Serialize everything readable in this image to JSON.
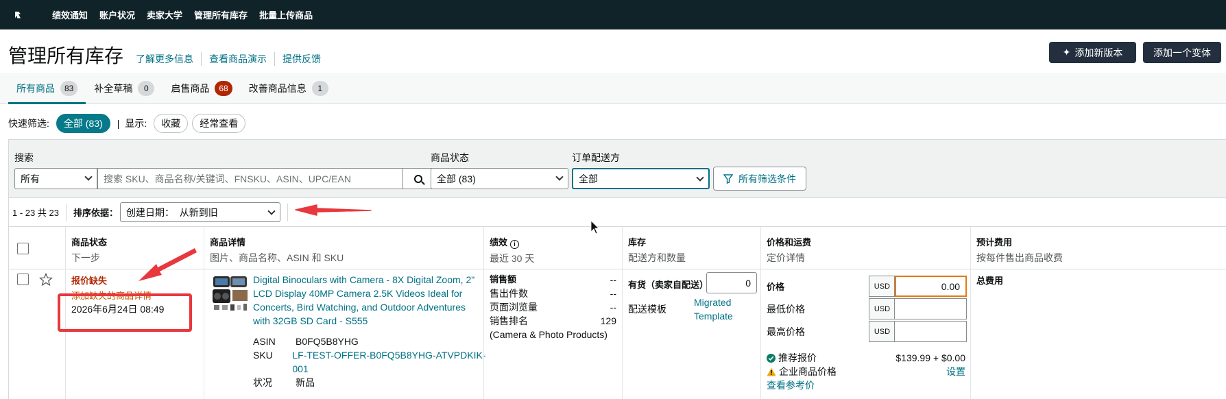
{
  "nav": {
    "items": [
      "绩效通知",
      "账户状况",
      "卖家大学",
      "管理所有库存",
      "批量上传商品"
    ]
  },
  "header": {
    "title": "管理所有库存",
    "links": [
      "了解更多信息",
      "查看商品演示",
      "提供反馈"
    ],
    "add_version_label": "添加新版本",
    "add_variant_label": "添加一个变体"
  },
  "tabs": [
    {
      "label": "所有商品",
      "count": "83"
    },
    {
      "label": "补全草稿",
      "count": "0"
    },
    {
      "label": "启售商品",
      "count": "68"
    },
    {
      "label": "改善商品信息",
      "count": "1"
    }
  ],
  "quick_filter": {
    "label": "快速筛选:",
    "all": "全部 (83)",
    "show_label": "显示:",
    "favorites": "收藏",
    "frequent": "经常查看"
  },
  "search": {
    "label": "搜索",
    "scope": "所有",
    "placeholder": "搜索 SKU、商品名称/关键词、FNSKU、ASIN、UPC/EAN",
    "status_label": "商品状态",
    "status_value": "全部 (83)",
    "fulfillment_label": "订单配送方",
    "fulfillment_value": "全部",
    "all_filters_label": "所有筛选条件"
  },
  "results": {
    "range": "1 - 23 共 23",
    "sort_label": "排序依据：",
    "sort_value": "创建日期：  从新到旧"
  },
  "columns": {
    "status": {
      "title": "商品状态",
      "sub": "下一步"
    },
    "details": {
      "title": "商品详情",
      "sub": "图片、商品名称、ASIN 和 SKU"
    },
    "performance": {
      "title": "绩效",
      "sub": "最近 30 天"
    },
    "inventory": {
      "title": "库存",
      "sub": "配送方和数量"
    },
    "pricing": {
      "title": "价格和运费",
      "sub": "定价详情"
    },
    "fees": {
      "title": "预计费用",
      "sub": "按每件售出商品收费"
    }
  },
  "row": {
    "status": "报价缺失",
    "next_step": "添加缺失的商品详情",
    "created": "2026年6月24日 08:49",
    "title": "Digital Binoculars with Camera - 8X Digital Zoom, 2\" LCD Display 40MP Camera 2.5K Videos Ideal for Concerts, Bird Watching, and Outdoor Adventures with 32GB SD Card - S555",
    "asin_label": "ASIN",
    "asin": "B0FQ5B8YHG",
    "sku_label": "SKU",
    "sku": "LF-TEST-OFFER-B0FQ5B8YHG-ATVPDKIK-001",
    "condition_label": "状况",
    "condition": "新品",
    "perf": {
      "sales_label": "销售额",
      "sales": "--",
      "units_label": "售出件数",
      "units": "--",
      "views_label": "页面浏览量",
      "views": "--",
      "rank_label": "销售排名",
      "rank": "129",
      "rank_category": "(Camera & Photo Products)"
    },
    "inventory": {
      "fulfillment": "有货（卖家自配送）",
      "qty": "0",
      "template_label": "配送模板",
      "template": "Migrated Template"
    },
    "pricing": {
      "price_label": "价格",
      "currency": "USD",
      "price": "0.00",
      "min_label": "最低价格",
      "max_label": "最高价格",
      "recommended_label": "推荐报价",
      "recommended": "$139.99 + $0.00",
      "business_label": "企业商品价格",
      "business_action": "设置",
      "reference_link": "查看参考价"
    },
    "fees_label": "总费用"
  }
}
